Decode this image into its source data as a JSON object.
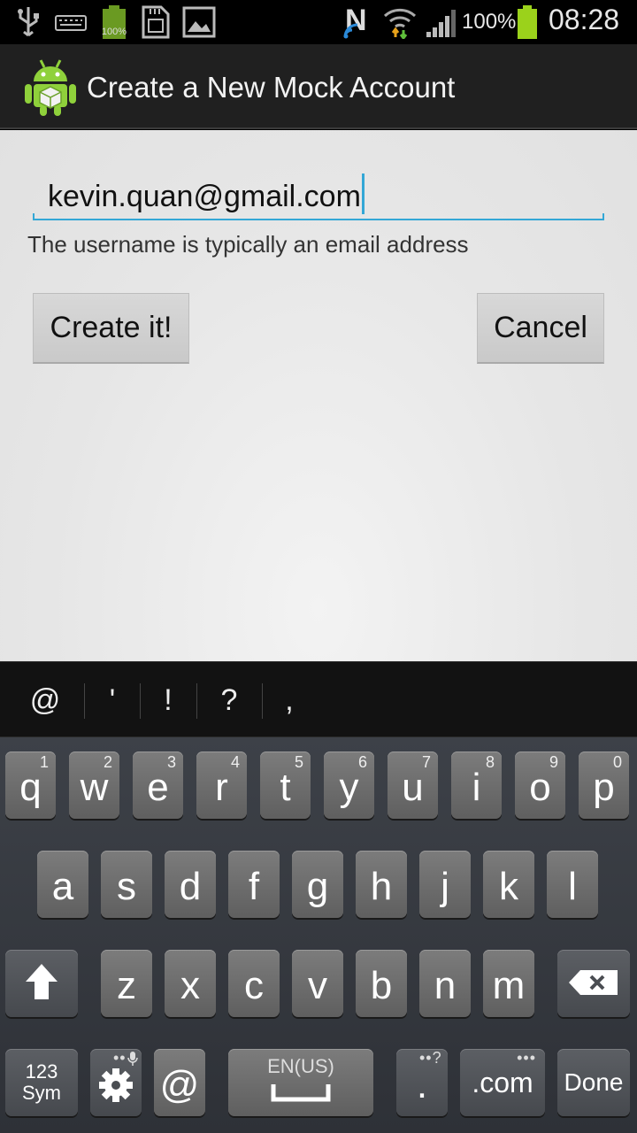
{
  "status_bar": {
    "battery_small_pct": "100%",
    "battery_pct": "100%",
    "time": "08:28",
    "icons": [
      "usb-icon",
      "keyboard-icon",
      "battery-small-icon",
      "sd-card-icon",
      "gallery-icon",
      "nfc-icon",
      "wifi-icon",
      "signal-icon",
      "battery-icon"
    ]
  },
  "action_bar": {
    "title": "Create a New Mock Account",
    "icon": "android-app-icon"
  },
  "form": {
    "username_value": "kevin.quan@gmail.com",
    "hint": "The username is typically an email address",
    "create_label": "Create it!",
    "cancel_label": "Cancel",
    "accent_color": "#33a7d6"
  },
  "keyboard": {
    "suggestions": [
      "@",
      "'",
      "!",
      "?",
      ","
    ],
    "row1": [
      {
        "char": "q",
        "num": "1"
      },
      {
        "char": "w",
        "num": "2"
      },
      {
        "char": "e",
        "num": "3"
      },
      {
        "char": "r",
        "num": "4"
      },
      {
        "char": "t",
        "num": "5"
      },
      {
        "char": "y",
        "num": "6"
      },
      {
        "char": "u",
        "num": "7"
      },
      {
        "char": "i",
        "num": "8"
      },
      {
        "char": "o",
        "num": "9"
      },
      {
        "char": "p",
        "num": "0"
      }
    ],
    "row2": [
      "a",
      "s",
      "d",
      "f",
      "g",
      "h",
      "j",
      "k",
      "l"
    ],
    "row3": [
      "z",
      "x",
      "c",
      "v",
      "b",
      "n",
      "m"
    ],
    "sym_line1": "123",
    "sym_line2": "Sym",
    "at_key": "@",
    "space_lang": "EN(US)",
    "period_key": ".",
    "period_extra": "?",
    "dotcom_key": ".com",
    "done_key": "Done"
  }
}
